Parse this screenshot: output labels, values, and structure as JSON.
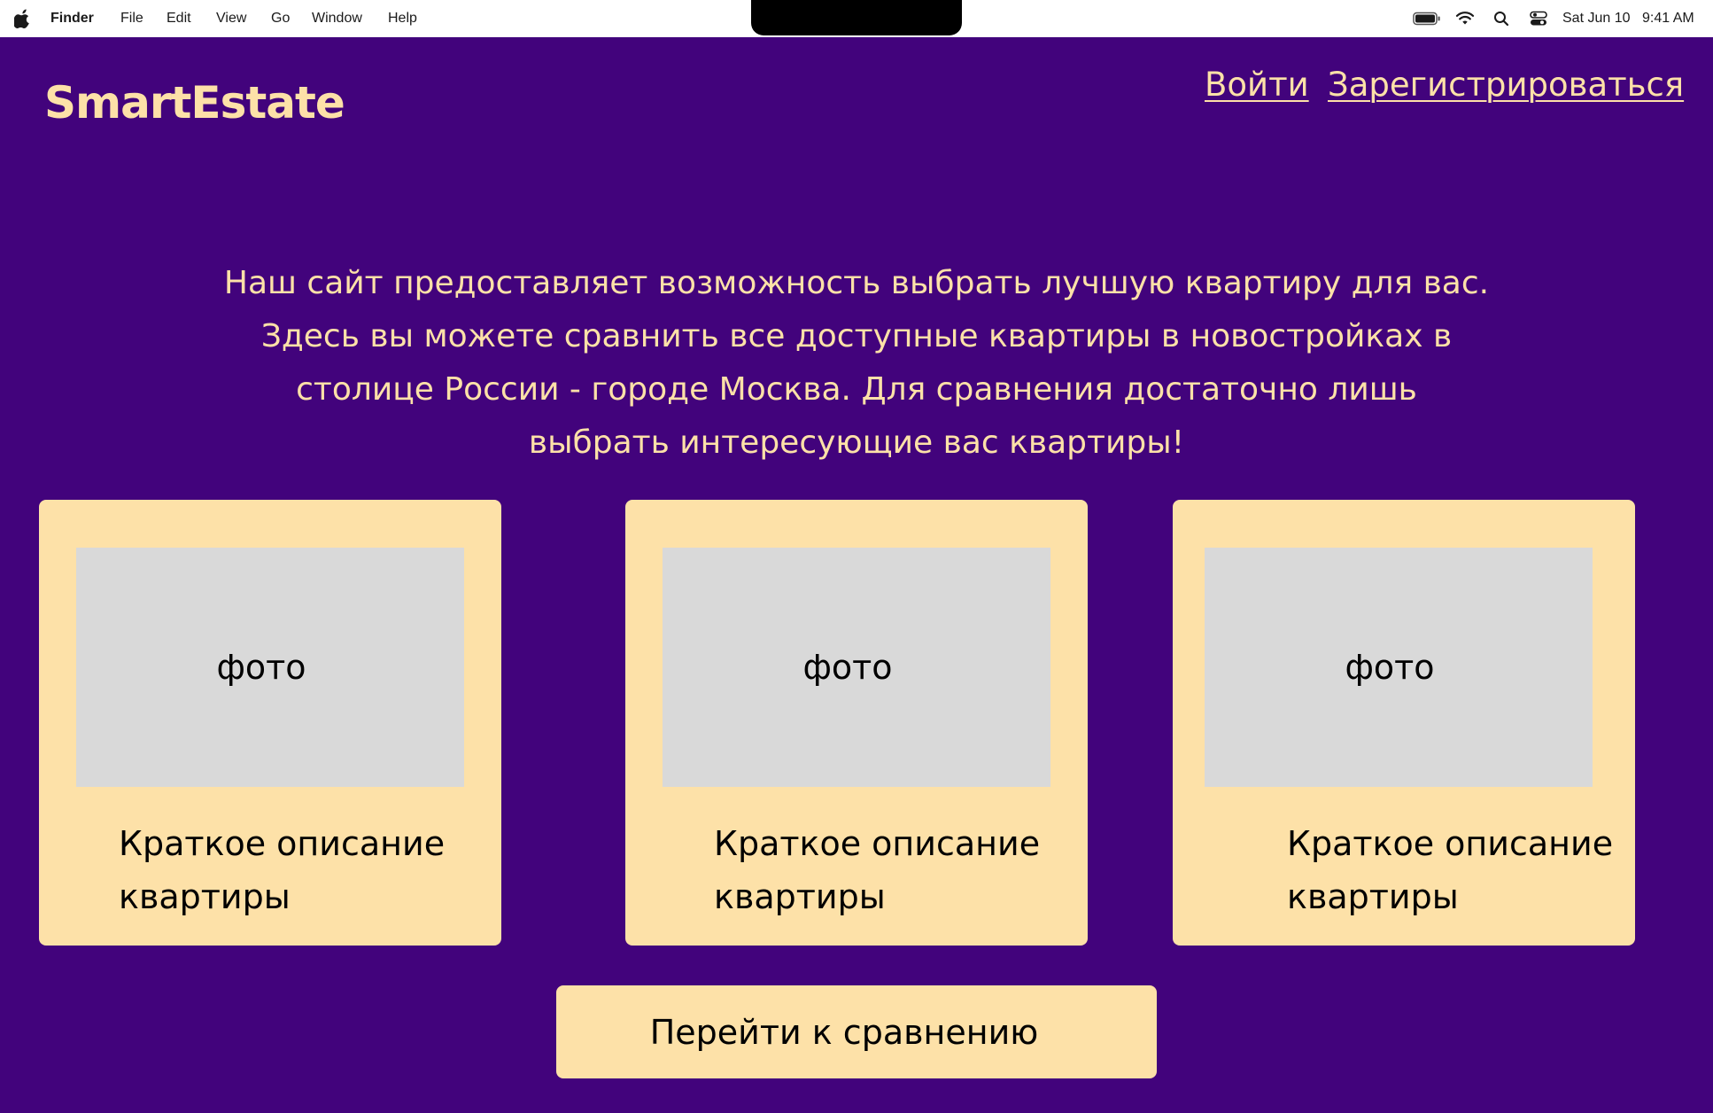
{
  "menubar": {
    "app_name": "Finder",
    "items": [
      "File",
      "Edit",
      "View",
      "Go",
      "Window",
      "Help"
    ],
    "date": "Sat Jun 10",
    "time": "9:41 AM",
    "icons": [
      "apple-logo-icon",
      "battery-icon",
      "wifi-icon",
      "search-icon",
      "control-center-icon"
    ]
  },
  "header": {
    "logo": "SmartEstate",
    "login": "Войти",
    "register": "Зарегистрироваться"
  },
  "intro": {
    "lines": [
      "Наш сайт предоставляет возможность выбрать лучшую квартиру для вас.",
      "Здесь вы можете сравнить все доступные квартиры в новостройках в",
      "столице России - городе Москва. Для сравнения достаточно лишь",
      "выбрать интересующие вас квартиры!"
    ]
  },
  "cards": [
    {
      "photo": "фото",
      "desc_line1": "Краткое описание",
      "desc_line2": "квартиры"
    },
    {
      "photo": "фото",
      "desc_line1": "Краткое описание",
      "desc_line2": "квартиры"
    },
    {
      "photo": "фото",
      "desc_line1": "Краткое описание",
      "desc_line2": "квартиры"
    }
  ],
  "compare_button": "Перейти к сравнению",
  "colors": {
    "background": "#42037c",
    "accent": "#fde1a8",
    "photo_placeholder": "#d9d9d9",
    "menubar": "#ffffff"
  }
}
